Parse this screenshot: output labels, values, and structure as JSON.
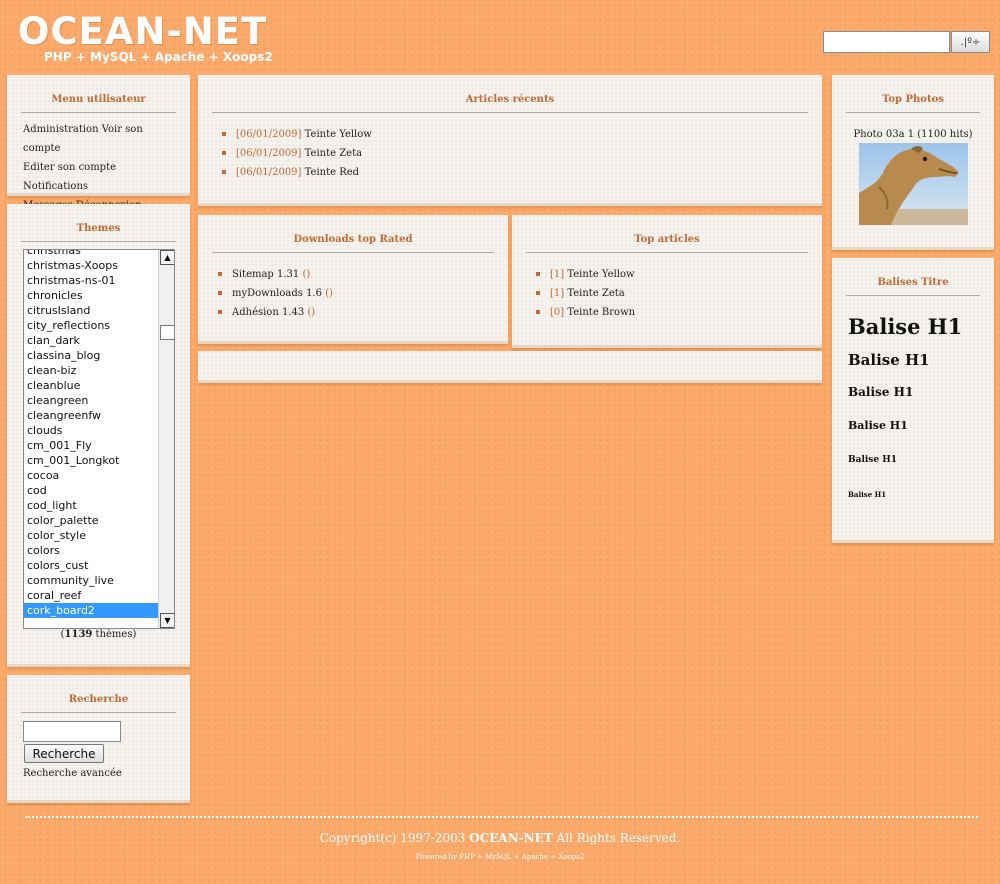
{
  "header": {
    "logo_title": "OCEAN-NET",
    "logo_subtitle": "PHP + MySQL + Apache + Xoops2",
    "search_button": ".|º÷"
  },
  "user_menu": {
    "title": "Menu utilisateur",
    "lines": [
      "Administration Voir son compte",
      "Editer son compte Notifications",
      "Messages Déconnexion"
    ]
  },
  "themes": {
    "title": "Themes",
    "items": [
      "christmas",
      "christmas-Xoops",
      "christmas-ns-01",
      "chronicles",
      "citrusIsland",
      "city_reflections",
      "clan_dark",
      "classina_blog",
      "clean-biz",
      "cleanblue",
      "cleangreen",
      "cleangreenfw",
      "clouds",
      "cm_001_Fly",
      "cm_001_Longkot",
      "cocoa",
      "cod",
      "cod_light",
      "color_palette",
      "color_style",
      "colors",
      "colors_cust",
      "community_live",
      "coral_reef",
      "cork_board2"
    ],
    "selected": "cork_board2",
    "count_open": "(",
    "count": "1139",
    "count_label": " thèmes)"
  },
  "recherche": {
    "title": "Recherche",
    "button": "Recherche",
    "advanced": "Recherche avancée"
  },
  "recent_articles": {
    "title": "Articles récents",
    "items": [
      {
        "date": "[06/01/2009]",
        "name": "Teinte Yellow"
      },
      {
        "date": "[06/01/2009]",
        "name": "Teinte Zeta"
      },
      {
        "date": "[06/01/2009]",
        "name": "Teinte Red"
      }
    ]
  },
  "downloads": {
    "title": "Downloads top Rated",
    "items": [
      {
        "name": "Sitemap 1.31",
        "link": "()"
      },
      {
        "name": "myDownloads 1.6",
        "link": "()"
      },
      {
        "name": "Adhésion 1.43",
        "link": "()"
      }
    ]
  },
  "top_articles": {
    "title": "Top articles",
    "items": [
      {
        "count": "[1]",
        "name": "Teinte Yellow"
      },
      {
        "count": "[1]",
        "name": "Teinte Zeta"
      },
      {
        "count": "[0]",
        "name": "Teinte Brown"
      }
    ]
  },
  "top_photos": {
    "title": "Top Photos",
    "caption": "Photo 03a 1 (1100 hits)"
  },
  "balises": {
    "title": "Balises Titre",
    "headings": [
      "Balise H1",
      "Balise H1",
      "Balise H1",
      "Balise H1",
      "Balise H1",
      "Balise H1"
    ]
  },
  "footer": {
    "copy_prefix": "Copyright(c) 1997-2003 ",
    "copy_brand": "OCEAN-NET",
    "copy_suffix": " All Rights Reserved.",
    "powered": "Powered by PHP + MySQL + Apache + Xoops2"
  },
  "colors": {
    "background": "#fba868",
    "accent": "#c46a35",
    "box": "#f6f2ed",
    "selection": "#3399ff"
  }
}
